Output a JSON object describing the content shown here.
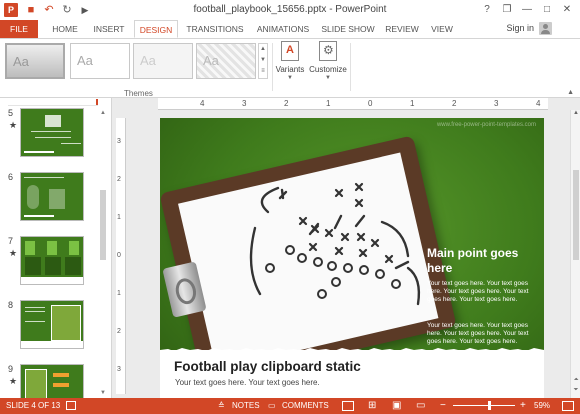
{
  "window": {
    "title": "football_playbook_15656.pptx - PowerPoint",
    "help_label": "?",
    "restore_label": "❐",
    "minimize_label": "—",
    "maximize_label": "□",
    "close_label": "✕"
  },
  "quick_access": {
    "save": "■",
    "undo": "↶",
    "redo": "↻",
    "start": "▶"
  },
  "tabs": [
    "FILE",
    "HOME",
    "INSERT",
    "DESIGN",
    "TRANSITIONS",
    "ANIMATIONS",
    "SLIDE SHOW",
    "REVIEW",
    "VIEW"
  ],
  "active_tab": "DESIGN",
  "account": {
    "signin_label": "Sign in"
  },
  "ribbon": {
    "themes": [
      {
        "sample": "Aa"
      },
      {
        "sample": "Aa"
      },
      {
        "sample": "Aa"
      },
      {
        "sample": "Aa"
      }
    ],
    "variants_label": "Variants",
    "customize_label": "Customize",
    "group_label": "Themes"
  },
  "thumbnails": [
    {
      "number": "5",
      "star": "★"
    },
    {
      "number": "6",
      "star": ""
    },
    {
      "number": "7",
      "star": "★"
    },
    {
      "number": "8",
      "star": ""
    },
    {
      "number": "9",
      "star": "★"
    }
  ],
  "ruler": {
    "horizontal": [
      "4",
      "3",
      "2",
      "1",
      "0",
      "1",
      "2",
      "3",
      "4"
    ],
    "vertical": [
      "3",
      "2",
      "1",
      "0",
      "1",
      "2",
      "3"
    ]
  },
  "slide": {
    "website": "www.free-power-point-templates.com",
    "main_point": "Main point goes here",
    "paragraph_1": "Your text goes here. Your text goes here. Your text goes here. Your text goes here. Your text goes here.",
    "paragraph_2": "Your text goes here. Your text goes here. Your text goes here. Your text goes here. Your text goes here.",
    "title": "Football play clipboard static",
    "subtitle": "Your text goes here. Your text goes here."
  },
  "status": {
    "slide_info": "SLIDE 4 OF 13",
    "notes_label": "NOTES",
    "comments_label": "COMMENTS",
    "zoom_minus": "−",
    "zoom_plus": "+",
    "zoom_level": "59%"
  },
  "colors": {
    "accent": "#d24726",
    "slide_green": "#3f7b1c"
  }
}
